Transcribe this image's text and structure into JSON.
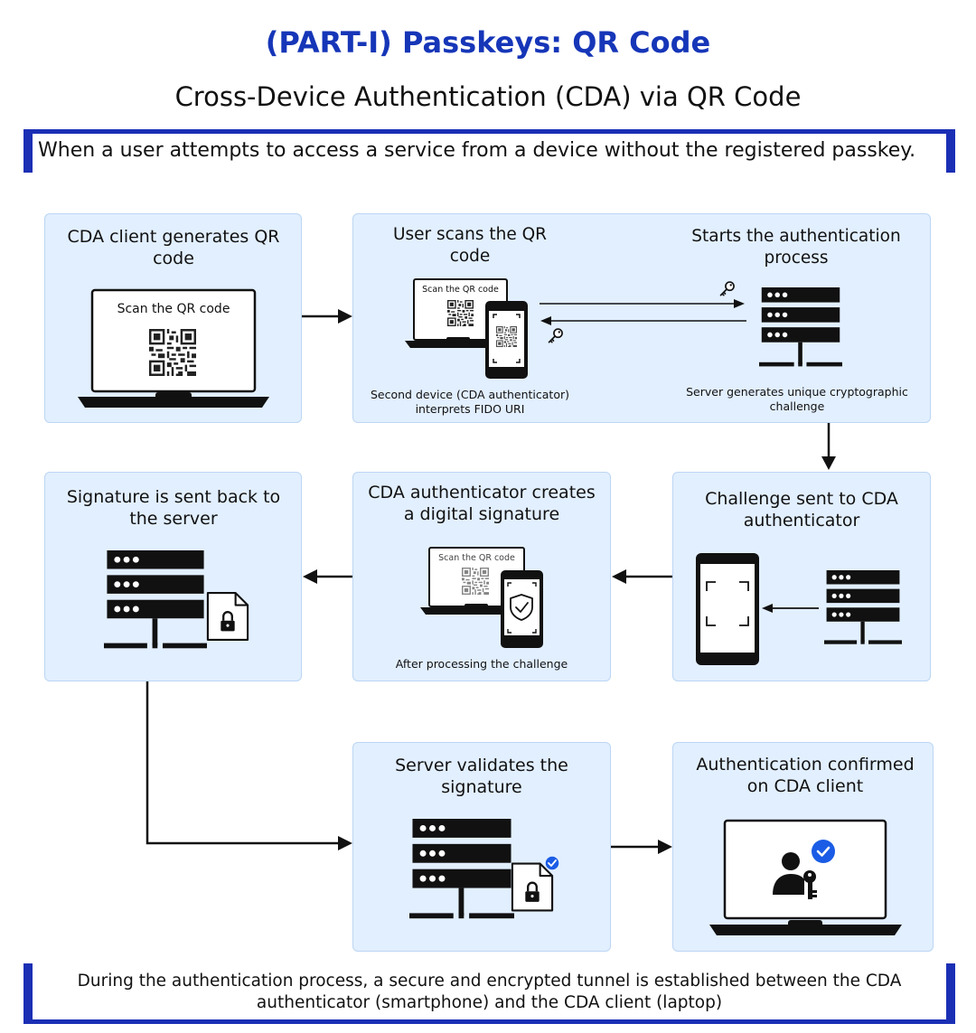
{
  "header": {
    "title": "(PART-I) Passkeys: QR Code",
    "subtitle": "Cross-Device Authentication (CDA) via QR Code",
    "banner": "When a user attempts to access a service from a device without the registered passkey."
  },
  "steps": {
    "s1": {
      "title": "CDA client generates QR code",
      "screen_text": "Scan the QR code"
    },
    "s2": {
      "title": "User scans the QR code",
      "screen_text": "Scan the QR code",
      "caption": "Second device (CDA authenticator) interprets FIDO URI"
    },
    "s3": {
      "title": "Starts the authentication process",
      "caption": "Server generates unique cryptographic challenge"
    },
    "s4": {
      "title": "Challenge sent to CDA authenticator"
    },
    "s5": {
      "title": "CDA authenticator creates a digital signature",
      "screen_text": "Scan the QR code",
      "caption": "After processing the challenge"
    },
    "s6": {
      "title": "Signature is sent back to the server"
    },
    "s7": {
      "title": "Server validates the signature"
    },
    "s8": {
      "title": "Authentication confirmed on CDA client"
    }
  },
  "footer": {
    "text": "During the authentication process, a secure and encrypted tunnel is established between the CDA authenticator (smartphone) and the CDA client (laptop)"
  },
  "icons": [
    "laptop-icon",
    "qr-code-icon",
    "smartphone-icon",
    "server-icon",
    "key-icon",
    "locked-document-icon",
    "shield-check-icon",
    "user-key-icon",
    "check-badge-icon",
    "arrow-icon"
  ],
  "colors": {
    "title": "#1636b8",
    "accent": "#1b2fb5",
    "card": "#e2efff",
    "badge": "#1a5ce5"
  }
}
